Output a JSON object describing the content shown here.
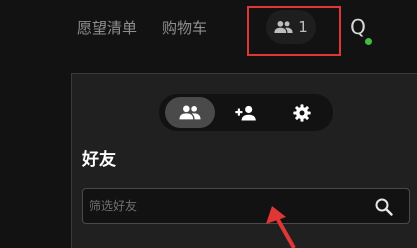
{
  "header": {
    "wishlist_label": "愿望清单",
    "cart_label": "购物车",
    "friends_count": "1",
    "avatar_initial": "Q",
    "online_color": "#3fbf3f"
  },
  "friends_panel": {
    "tabs": [
      {
        "icon": "people-icon",
        "active": true
      },
      {
        "icon": "add-friend-icon",
        "active": false
      },
      {
        "icon": "gear-icon",
        "active": false
      }
    ],
    "title": "好友",
    "filter": {
      "placeholder": "筛选好友",
      "value": ""
    }
  },
  "annotation_color": "#e03636"
}
